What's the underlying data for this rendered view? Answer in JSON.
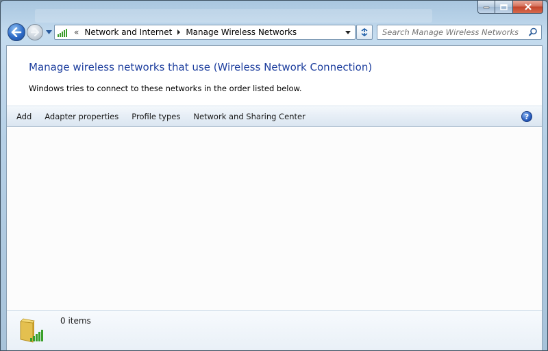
{
  "window": {
    "caption": {
      "minimize_icon": "minimize-icon",
      "maximize_icon": "maximize-icon",
      "close_icon": "close-icon"
    }
  },
  "navigation": {
    "back_icon": "back-arrow-icon",
    "forward_icon": "forward-arrow-icon",
    "address": {
      "overflow": "«",
      "breadcrumbs": [
        "Network and Internet",
        "Manage Wireless Networks"
      ]
    },
    "search": {
      "placeholder": "Search Manage Wireless Networks"
    }
  },
  "main": {
    "heading": "Manage wireless networks that use (Wireless Network Connection)",
    "subheading": "Windows tries to connect to these networks in the order listed below."
  },
  "toolbar": {
    "items": [
      "Add",
      "Adapter properties",
      "Profile types",
      "Network and Sharing Center"
    ],
    "help_label": "?"
  },
  "details": {
    "items_count": "0 items"
  },
  "colors": {
    "heading": "#1e3f9e",
    "signal_bars": "#3a9b2a",
    "accent": "#2d6bc7"
  }
}
